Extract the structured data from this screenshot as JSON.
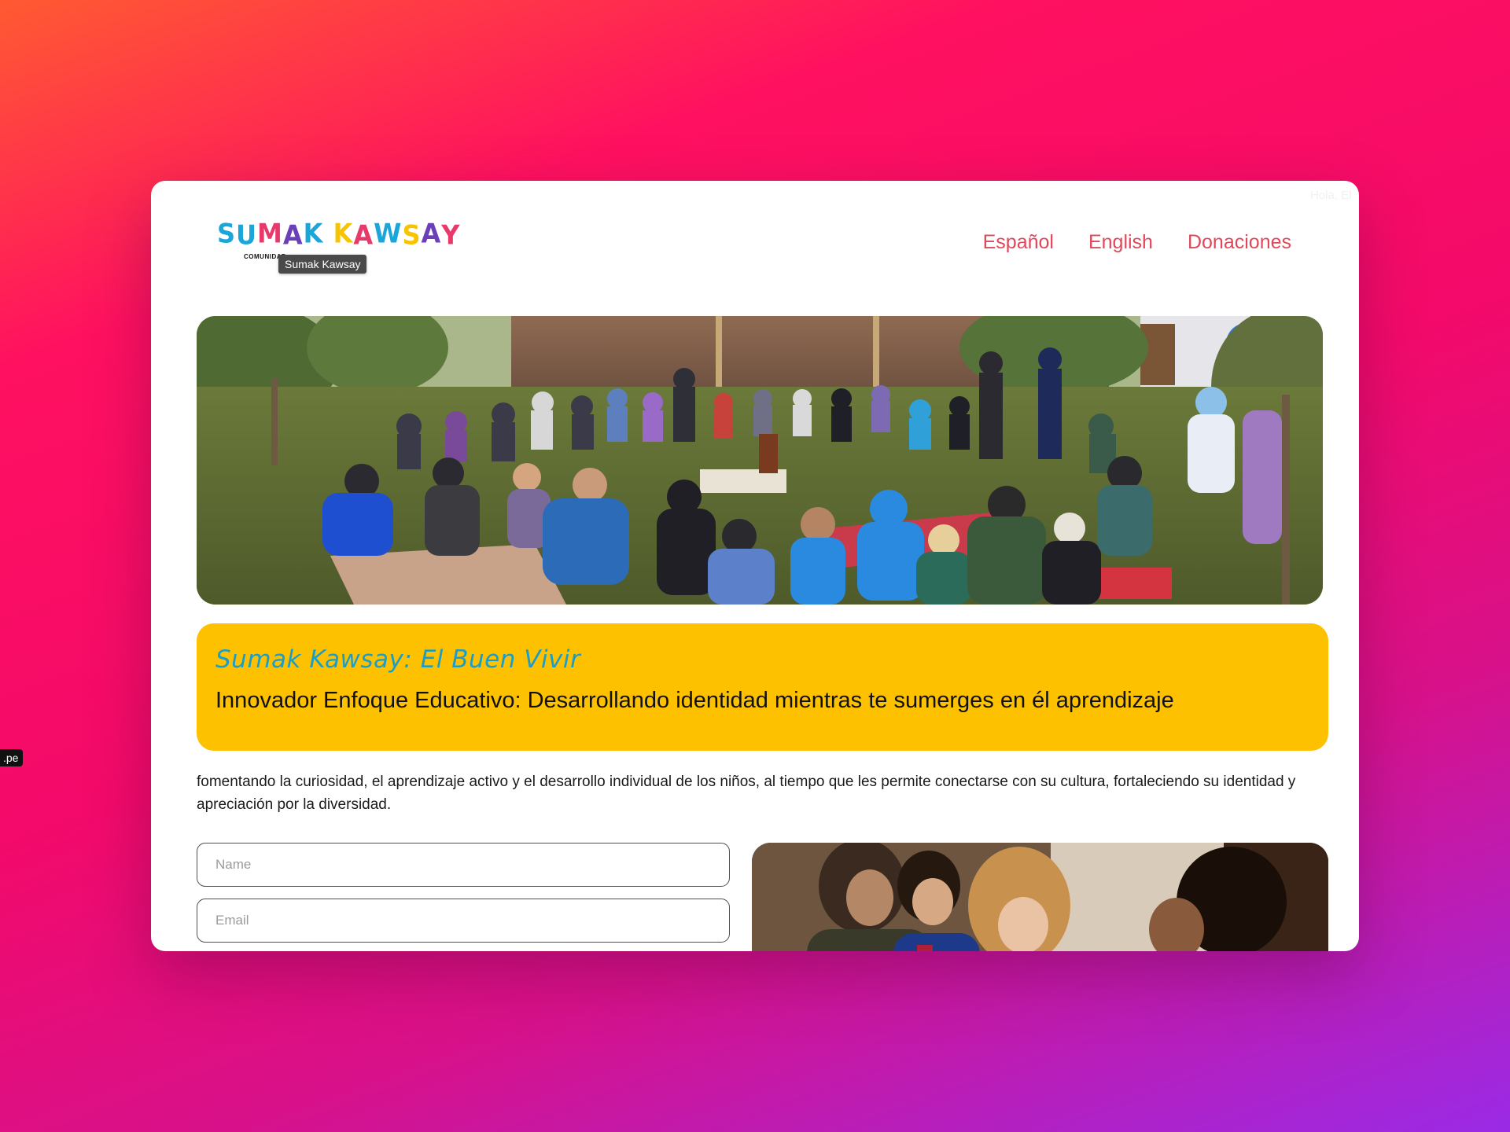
{
  "browser": {
    "ghost_text": "Hola, El",
    "corner_badge": ".pe"
  },
  "header": {
    "logo_text": "SUMAK KAWSAY",
    "logo_letters": [
      {
        "ch": "S",
        "color": "#1aa6d9"
      },
      {
        "ch": "U",
        "color": "#1aa6d9"
      },
      {
        "ch": "M",
        "color": "#e8396b"
      },
      {
        "ch": "A",
        "color": "#6b3fb8"
      },
      {
        "ch": "K",
        "color": "#1aa6d9"
      },
      {
        "ch": " ",
        "color": "#000000"
      },
      {
        "ch": "K",
        "color": "#f6c400"
      },
      {
        "ch": "A",
        "color": "#e8396b"
      },
      {
        "ch": "W",
        "color": "#1aa6d9"
      },
      {
        "ch": "S",
        "color": "#f6c400"
      },
      {
        "ch": "A",
        "color": "#6b3fb8"
      },
      {
        "ch": "Y",
        "color": "#e8396b"
      }
    ],
    "logo_subtitle": "COMUNIDAD",
    "logo_tooltip": "Sumak Kawsay",
    "nav": [
      {
        "label": "Español"
      },
      {
        "label": "English"
      },
      {
        "label": "Donaciones"
      }
    ],
    "nav_color": "#e0485a"
  },
  "banner": {
    "kicker": "Sumak Kawsay: El Buen Vivir",
    "title": "Innovador Enfoque Educativo: Desarrollando identidad mientras te sumerges en él aprendizaje",
    "background": "#fdc100",
    "kicker_color": "#1a9ec9"
  },
  "intro": {
    "text": "fomentando la curiosidad, el aprendizaje activo y el desarrollo individual de los niños, al tiempo que les permite conectarse con su cultura, fortaleciendo su identidad y apreciación por la diversidad."
  },
  "form": {
    "name_placeholder": "Name",
    "email_placeholder": "Email"
  }
}
